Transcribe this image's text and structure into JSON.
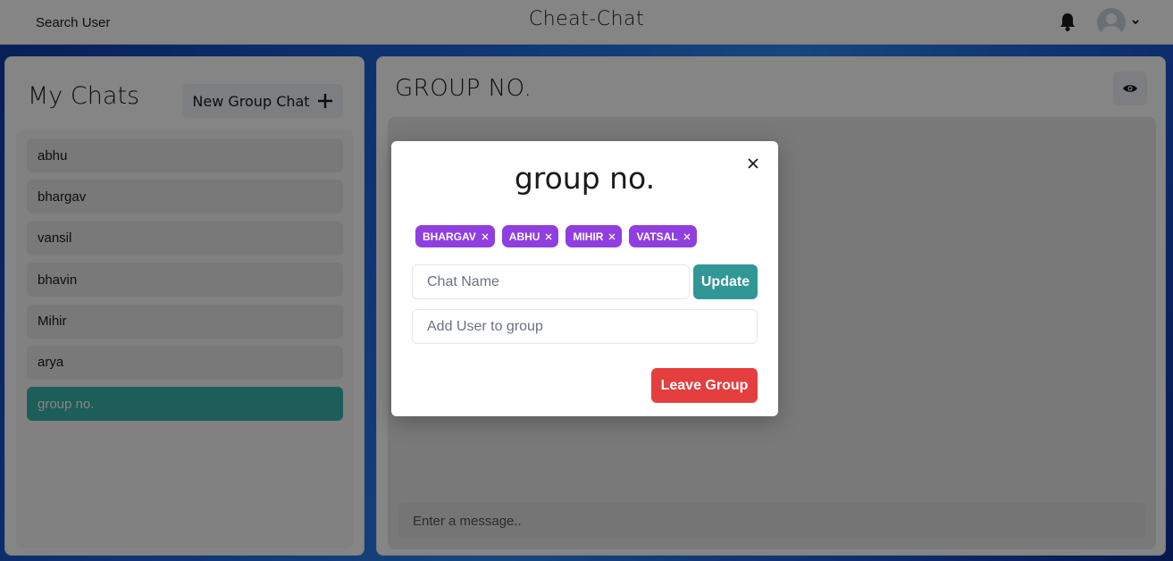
{
  "header": {
    "search_label": "Search User",
    "app_title": "Cheat-Chat"
  },
  "sidebar": {
    "title": "My Chats",
    "new_group_label": "New Group Chat",
    "chats": [
      {
        "name": "abhu",
        "active": false
      },
      {
        "name": "bhargav",
        "active": false
      },
      {
        "name": "vansil",
        "active": false
      },
      {
        "name": "bhavin",
        "active": false
      },
      {
        "name": "Mihir",
        "active": false
      },
      {
        "name": "arya",
        "active": false
      },
      {
        "name": "group no.",
        "active": true
      }
    ]
  },
  "chat": {
    "heading": "GROUP NO.",
    "message_placeholder": "Enter a message.."
  },
  "modal": {
    "title": "group no.",
    "members": [
      "BHARGAV",
      "ABHU",
      "MIHIR",
      "VATSAL"
    ],
    "chat_name_placeholder": "Chat Name",
    "update_label": "Update",
    "add_user_placeholder": "Add User to group",
    "leave_label": "Leave Group"
  },
  "colors": {
    "accent_teal": "#319795",
    "active_chat": "#38b2ac",
    "badge_purple": "#8f3ee0",
    "danger_red": "#e53e3e"
  },
  "icons": {
    "bell": "bell-icon",
    "avatar": "user-avatar-icon",
    "chevron": "chevron-down-icon",
    "plus": "plus-icon",
    "eye": "eye-icon",
    "close": "close-icon",
    "badge_remove": "close-icon"
  }
}
